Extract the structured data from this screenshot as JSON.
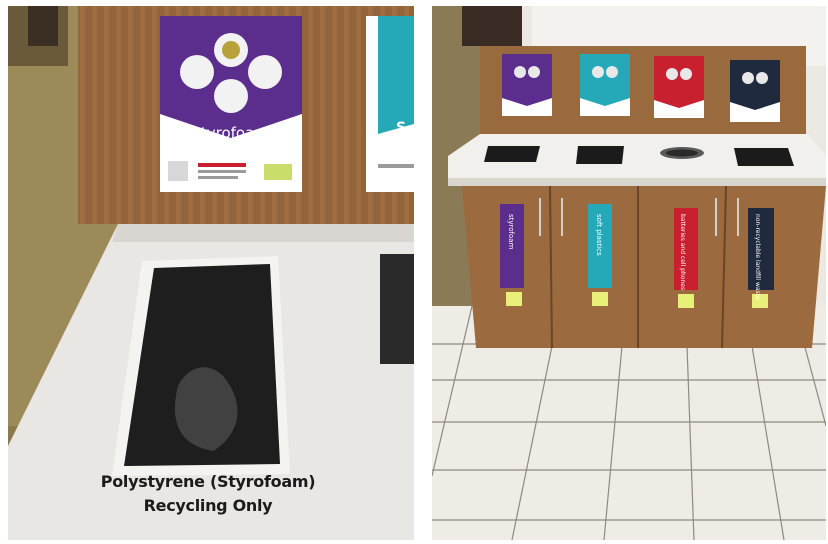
{
  "left_photo": {
    "sign_label": "styrofoam",
    "partial_sign_letter": "S",
    "counter_caption_line1": "Polystyrene (Styrofoam)",
    "counter_caption_line2": "Recycling Only"
  },
  "right_photo": {
    "bin_labels": [
      "styrofoam",
      "soft plastics",
      "batteries and cell phones",
      "non-recyclable landfill waste"
    ]
  },
  "colors": {
    "purple": "#5b2d8c",
    "teal": "#25a9b8",
    "red": "#c8202f",
    "navy": "#1f2a3e",
    "wood": "#9a6a3f",
    "counter": "#eceae6"
  }
}
